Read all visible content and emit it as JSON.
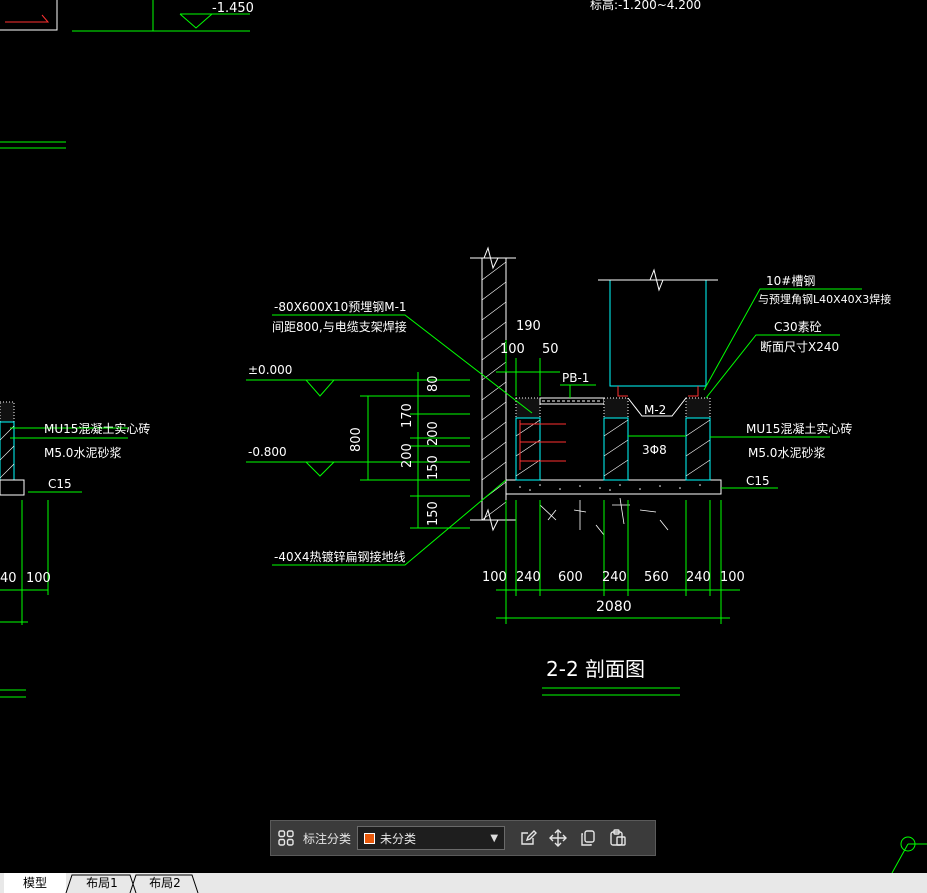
{
  "drawing": {
    "top_level_label": "-1.450",
    "top_note": "标高:-1.200~4.200",
    "section_title": "2-2 剖面图",
    "left_labels": {
      "plate": "-80X600X10预埋钢M-1",
      "plate_note": "间距800,与电缆支架焊接",
      "level_zero": "±0.000",
      "level_minus": "-0.800",
      "ground_wire": "-40X4热镀锌扁钢接地线"
    },
    "right_labels": {
      "channel": "10#槽钢",
      "channel_note": "与预埋角钢L40X40X3焊接",
      "concrete": "C30素砼",
      "concrete_note": "断面尺寸X240",
      "brick": "MU15混凝土实心砖",
      "mortar": "M5.0水泥砂浆",
      "c15": "C15"
    },
    "left_partial": {
      "brick": "MU15混凝土实心砖",
      "mortar": "M5.0水泥砂浆",
      "c15": "C15",
      "dim_a": "40",
      "dim_b": "100"
    },
    "tags": {
      "pb": "PB-1",
      "m2": "M-2",
      "rebar": "3Φ8"
    },
    "vertical_dims": [
      "80",
      "170",
      "200",
      "200",
      "150",
      "150"
    ],
    "total_height": "800",
    "top_dims": [
      "190",
      "100",
      "50"
    ],
    "bottom_dims": [
      "100",
      "240",
      "600",
      "240",
      "560",
      "240",
      "100"
    ],
    "total_width": "2080"
  },
  "toolbar": {
    "category_label": "标注分类",
    "selected_category": "未分类",
    "icons": [
      "grid-icon",
      "edit-icon",
      "move-icon",
      "copy-icon",
      "paste-icon"
    ]
  },
  "tabs": [
    "模型",
    "布局1",
    "布局2"
  ],
  "colors": {
    "background": "#000000",
    "line_white": "#ffffff",
    "line_green": "#00ff00",
    "line_cyan": "#00ffff",
    "hatch_red": "#ff3030",
    "category_swatch": "#e8590c"
  }
}
